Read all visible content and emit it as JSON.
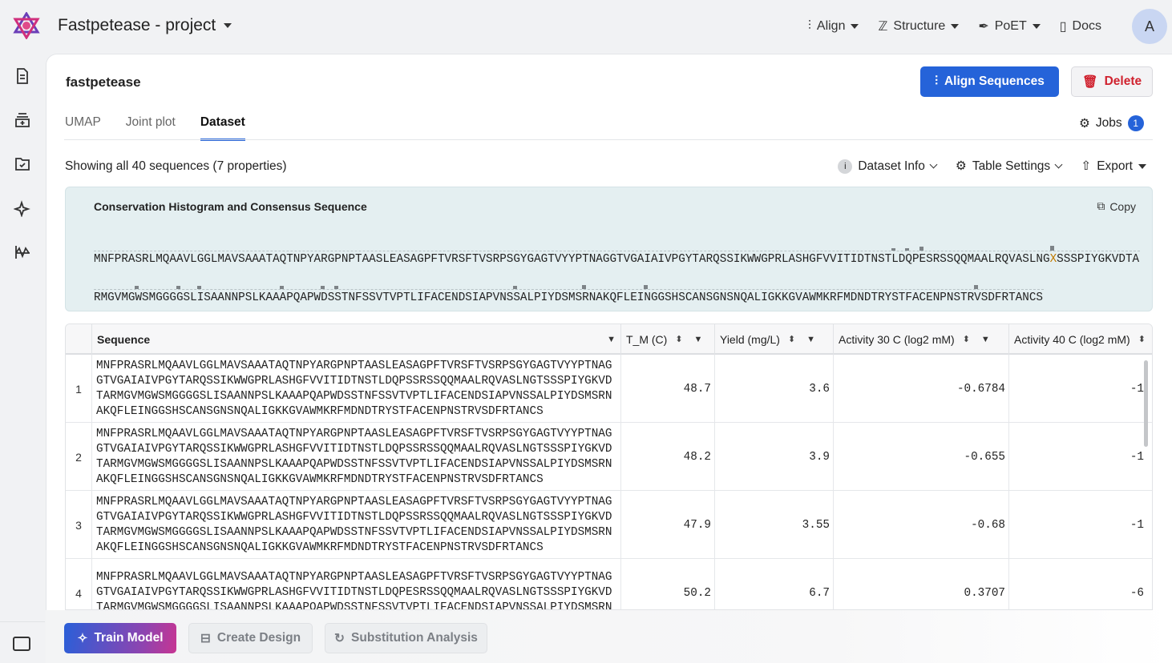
{
  "header": {
    "project": "Fastpetease - project",
    "nav": [
      {
        "label": "Align",
        "icon": "align-icon"
      },
      {
        "label": "Structure",
        "icon": "structure-icon"
      },
      {
        "label": "PoET",
        "icon": "feather-icon"
      },
      {
        "label": "Docs",
        "icon": "book-icon"
      }
    ],
    "avatar": "A"
  },
  "page": {
    "title": "fastpetease",
    "align_button": "Align Sequences",
    "delete_button": "Delete",
    "tabs": [
      "UMAP",
      "Joint plot",
      "Dataset"
    ],
    "active_tab": "Dataset",
    "jobs_label": "Jobs",
    "jobs_count": "1"
  },
  "toolbar": {
    "showing": "Showing all 40 sequences (7 properties)",
    "dataset_info": "Dataset Info",
    "table_settings": "Table Settings",
    "export": "Export"
  },
  "consensus": {
    "title": "Conservation Histogram and Consensus Sequence",
    "copy": "Copy",
    "line1_before": "MNFPRASRLMQAAVLGGLMAVSAAATAQTNPYARGPNPTAASLEASAGPFTVRSFTVSRPSGYGAGTVYYPTNAGGTVGAIAIVPGYTARQSSIKWWGPRLASHGFVVITIDTNSTLDQPESRSSQQMAALRQVASLNG",
    "line1_x": "X",
    "line1_after": "SSSPIYGKVDTA",
    "line2": "RMGVMGWSMGGGGSLISAANNPSLKAAAPQAPWDSSTNFSSVTVPTLIFACENDSIAPVNSSALPIYDSMSRNAKQFLEINGGSHSCANSGNSNQALIGKKGVAWMKRFMDNDTRYSTFACENPNSTRVSDFRTANCS",
    "highlight_color": "#c07a00"
  },
  "table": {
    "columns": [
      "Sequence",
      "T_M (C)",
      "Yield (mg/L)",
      "Activity 30 C (log2 mM)",
      "Activity 40 C (log2 mM)"
    ],
    "rows": [
      {
        "index": "1",
        "lines": [
          "MNFPRASRLMQAAVLGGLMAVSAAATAQTNPYARGPNPTAASLEASAGPFTVRSFTVSRPSGYGAGTVYYPTNAG",
          "GTVGAIAIVPGYTARQSSIKWWGPRLASHGFVVITIDTNSTLDQPSSRSSQQMAALRQVASLNGTSSSPIYGKVD",
          "TARMGVMGWSMGGGGSLISAANNPSLKAAAPQAPWDSSTNFSSVTVPTLIFACENDSIAPVNSSALPIYDSMSRN",
          "AKQFLEINGGSHSCANSGNSNQALIGKKGVAWMKRFMDNDTRYSTFACENPNSTRVSDFRTANCS"
        ],
        "tm": "48.7",
        "yield": "3.6",
        "act30": "-0.6784",
        "act40": "-1"
      },
      {
        "index": "2",
        "lines": [
          "MNFPRASRLMQAAVLGGLMAVSAAATAQTNPYARGPNPTAASLEASAGPFTVRSFTVSRPSGYGAGTVYYPTNAG",
          "GTVGAIAIVPGYTARQSSIKWWGPRLASHGFVVITIDTNSTLDQPSSRSSQQMAALRQVASLNGTSSSPIYGKVD",
          "TARMGVMGWSMGGGGSLISAANNPSLKAAAPQAPWDSSTNFSSVTVPTLIFACENDSIAPVNSSALPIYDSMSRN",
          "AKQFLEINGGSHSCANSGNSNQALIGKKGVAWMKRFMDNDTRYSTFACENPNSTRVSDFRTANCS"
        ],
        "tm": "48.2",
        "yield": "3.9",
        "act30": "-0.655",
        "act40": "-1"
      },
      {
        "index": "3",
        "lines": [
          "MNFPRASRLMQAAVLGGLMAVSAAATAQTNPYARGPNPTAASLEASAGPFTVRSFTVSRPSGYGAGTVYYPTNAG",
          "GTVGAIAIVPGYTARQSSIKWWGPRLASHGFVVITIDTNSTLDQPSSRSSQQMAALRQVASLNGTSSSPIYGKVD",
          "TARMGVMGWSMGGGGSLISAANNPSLKAAAPQAPWDSSTNFSSVTVPTLIFACENDSIAPVNSSALPIYDSMSRN",
          "AKQFLEINGGSHSCANSGNSNQALIGKKGVAWMKRFMDNDTRYSTFACENPNSTRVSDFRTANCS"
        ],
        "tm": "47.9",
        "yield": "3.55",
        "act30": "-0.68",
        "act40": "-1"
      },
      {
        "index": "4",
        "lines": [
          "MNFPRASRLMQAAVLGGLMAVSAAATAQTNPYARGPNPTAASLEASAGPFTVRSFTVSRPSGYGAGTVYYPTNAG",
          "GTVGAIAIVPGYTARQSSIKWWGPRLASHGFVVITIDTNSTLDQPESRSSQQMAALRQVASLNGTSSSPIYGKVD",
          "TARMGVMGWSMGGGGSLISAANNPSLKAAAPQAPWDSSTNFSSVTVPTLIFACENDSIAPVNSSALPIYDSMSRN",
          ""
        ],
        "tm": "50.2",
        "yield": "6.7",
        "act30": "0.3707",
        "act40": "-6"
      }
    ]
  },
  "actions": {
    "train": "Train Model",
    "create": "Create Design",
    "substitution": "Substitution Analysis"
  }
}
